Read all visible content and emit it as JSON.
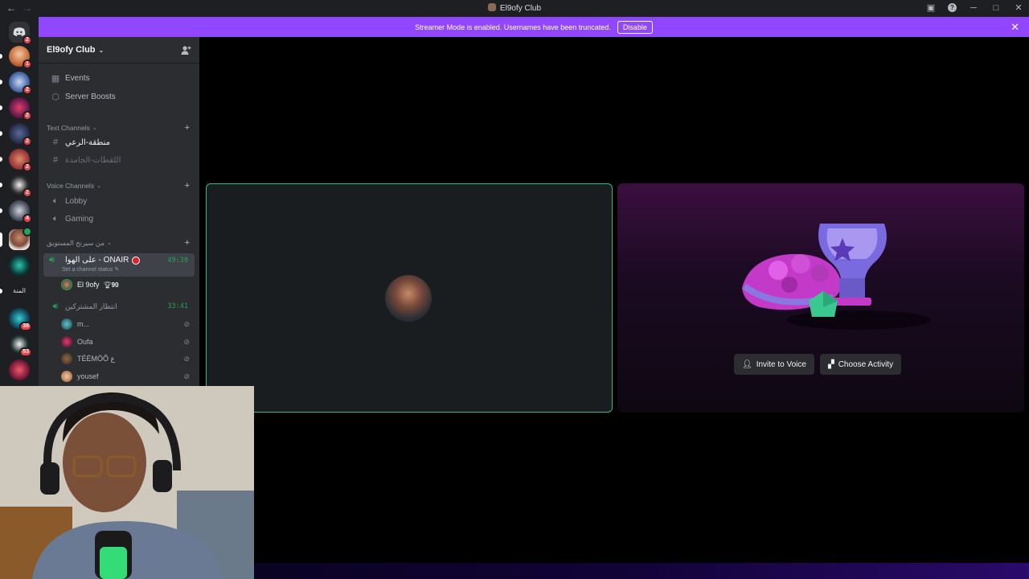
{
  "titlebar": {
    "back_icon": "arrow-left-icon",
    "forward_icon": "arrow-right-icon",
    "title": "El9ofy Club"
  },
  "banner": {
    "message": "Streamer Mode is enabled. Usernames have been truncated.",
    "disable_label": "Disable",
    "bg_color": "#9146ff"
  },
  "server": {
    "name": "El9ofy Club"
  },
  "sidebar": {
    "events_label": "Events",
    "boosts_label": "Server Boosts",
    "text_category": "Text Channels",
    "text_channels": [
      "منطقة-الرعي",
      "اللقطات-الجامدة"
    ],
    "voice_category": "Voice Channels",
    "voice_channels": [
      "Lobby",
      "Gaming"
    ],
    "stream_category": "من سيرنج المستويق",
    "active_channel": {
      "name": "على الهوا - ONAIR",
      "status": "Set a channel status",
      "timer": "49:30"
    },
    "active_user": {
      "name": "El 9ofy",
      "score": "90"
    },
    "second_channel": {
      "name": "انتظار المشتركين",
      "timer": "33:41"
    },
    "users": [
      "m...",
      "Oufa",
      "TÉÈMÖÕ ع",
      "yousef"
    ]
  },
  "guild_side": {
    "text_item": "المنة",
    "badges": [
      "2",
      "1",
      "2",
      "2",
      "2",
      "2",
      "2",
      "4",
      "38",
      "53"
    ]
  },
  "activity": {
    "invite_label": "Invite to Voice",
    "choose_label": "Choose Activity"
  },
  "colors": {
    "accent": "#9146ff",
    "speaking": "#43b581",
    "notification": "#f23f43"
  }
}
